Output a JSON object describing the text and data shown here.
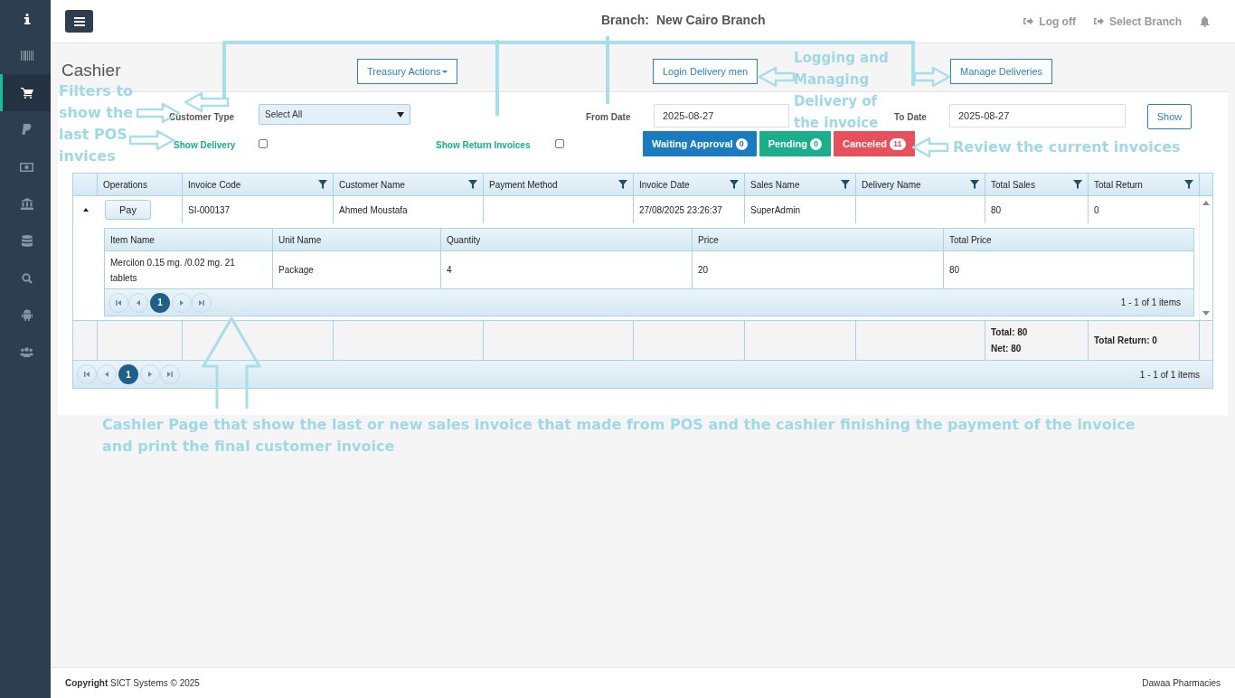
{
  "sidebar": {
    "items": [
      {
        "kind": "info",
        "selected": false
      },
      {
        "kind": "barcode",
        "selected": false
      },
      {
        "kind": "cart",
        "selected": true
      },
      {
        "kind": "paypal",
        "selected": false
      },
      {
        "kind": "money",
        "selected": false
      },
      {
        "kind": "bank",
        "selected": false
      },
      {
        "kind": "database",
        "selected": false
      },
      {
        "kind": "search",
        "selected": false
      },
      {
        "kind": "android",
        "selected": false
      },
      {
        "kind": "users",
        "selected": false
      }
    ]
  },
  "topbar": {
    "branch_label": "Branch:",
    "branch_name": "New Cairo Branch",
    "links": [
      {
        "kind": "logoff",
        "label": "Log off"
      },
      {
        "kind": "branch",
        "label": "Select Branch"
      },
      {
        "kind": "bell"
      }
    ]
  },
  "page": {
    "title": "Cashier",
    "actions": [
      {
        "label": "Treasury Actions",
        "dropdown": true
      },
      {
        "label": "Login Delivery men",
        "dropdown": false
      },
      {
        "label": "Manage Deliveries",
        "dropdown": false
      }
    ]
  },
  "filters": {
    "customer_type": {
      "label": "Customer Type",
      "value": "Select All"
    },
    "from_date": {
      "label": "From Date",
      "value": "2025-08-27"
    },
    "to_date": {
      "label": "To Date",
      "value": "2025-08-27"
    },
    "show_button": "Show",
    "show_delivery": {
      "label": "Show Delivery",
      "checked": false
    },
    "show_return_invoices": {
      "label": "Show Return Invoices",
      "checked": false
    }
  },
  "status_buttons": [
    {
      "kind": "waiting",
      "label": "Waiting Approval",
      "count": "0"
    },
    {
      "kind": "pending",
      "label": "Pending",
      "count": "0"
    },
    {
      "kind": "canceled",
      "label": "Canceled",
      "count": "11"
    }
  ],
  "grid": {
    "columns": [
      {
        "label": "Operations",
        "filter": false
      },
      {
        "label": "Invoice Code",
        "filter": true
      },
      {
        "label": "Customer Name",
        "filter": true
      },
      {
        "label": "Payment Method",
        "filter": true
      },
      {
        "label": "Invoice Date",
        "filter": true
      },
      {
        "label": "Sales Name",
        "filter": true
      },
      {
        "label": "Delivery Name",
        "filter": true
      },
      {
        "label": "Total Sales",
        "filter": true
      },
      {
        "label": "Total Return",
        "filter": true
      }
    ],
    "rows": [
      {
        "expanded": true,
        "cells": [
          "Pay",
          "SI-000137",
          "Ahmed Moustafa",
          null,
          "27/08/2025 23:26:37",
          "SuperAdmin",
          null,
          "80",
          "0"
        ],
        "detail": {
          "columns": [
            "Item Name",
            "Unit Name",
            "Quantity",
            "Price",
            "Total Price"
          ],
          "rows": [
            [
              "Mercilon 0.15 mg. /0.02 mg. 21 tablets",
              "Package",
              "4",
              "20",
              "80"
            ]
          ],
          "pager": {
            "pages": [
              {
                "label": "1",
                "selected": true
              }
            ],
            "summary": "1 - 1 of 1 items"
          }
        }
      }
    ],
    "footer": {
      "total_sales": [
        "Total: 80",
        "Net: 80"
      ],
      "total_return": "Total Return: 0"
    },
    "pager": {
      "pages": [
        {
          "label": "1",
          "selected": true
        }
      ],
      "summary": "1 - 1 of 1 items"
    }
  },
  "annotations": [
    {
      "kind": "filters",
      "text": "Filters to show the last POS invices"
    },
    {
      "kind": "delivery",
      "text": "Logging and Managing Delivery of the invoice"
    },
    {
      "kind": "review",
      "text": "Review the current invoices"
    },
    {
      "kind": "page",
      "text": "Cashier Page that show the last or new sales invoice that made from POS and the cashier finishing the payment of the invoice and print the final customer invoice"
    }
  ],
  "footer": {
    "copyright": "**Copyright** SICT Systems © 2025",
    "brand": "Dawaa Pharmacies"
  }
}
